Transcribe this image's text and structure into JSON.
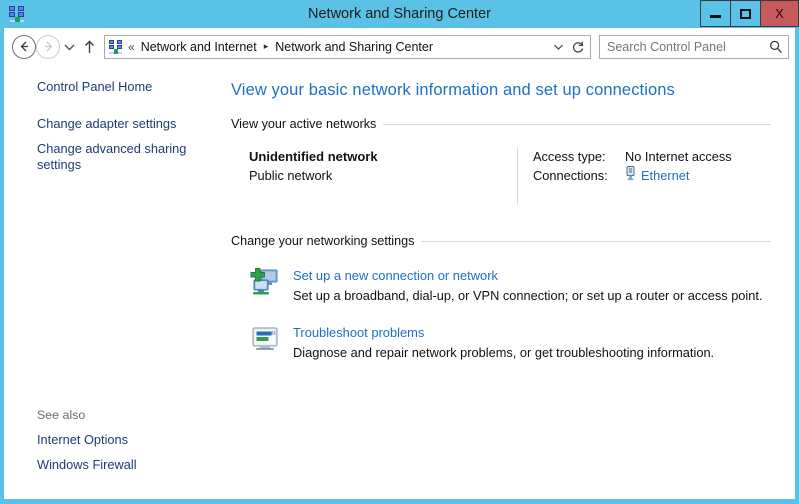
{
  "window": {
    "title": "Network and Sharing Center",
    "icon": "network-icon",
    "accent_color": "#5BC2E7",
    "close_color": "#C75B5B",
    "controls": {
      "minimize": "Minimize",
      "maximize": "Maximize",
      "close": "X"
    }
  },
  "navbar": {
    "back": "Back",
    "forward": "Forward",
    "recent_dropdown": "Recent locations",
    "up": "Up one level",
    "breadcrumb": {
      "prefix": "«",
      "items": [
        "Network and Internet",
        "Network and Sharing Center"
      ],
      "separator": "▸"
    },
    "address_dropdown": "Previous locations",
    "refresh": "Refresh",
    "search": {
      "placeholder": "Search Control Panel",
      "value": ""
    }
  },
  "sidebar": {
    "items": [
      {
        "label": "Control Panel Home"
      },
      {
        "label": "Change adapter settings"
      },
      {
        "label": "Change advanced sharing settings"
      }
    ],
    "see_also": {
      "label": "See also",
      "items": [
        {
          "label": "Internet Options"
        },
        {
          "label": "Windows Firewall"
        }
      ]
    }
  },
  "main": {
    "page_title": "View your basic network information and set up connections",
    "active_networks": {
      "heading": "View your active networks",
      "network": {
        "name": "Unidentified network",
        "type": "Public network",
        "access_type_label": "Access type:",
        "access_type_value": "No Internet access",
        "connections_label": "Connections:",
        "connection_name": "Ethernet",
        "connection_icon": "ethernet-icon"
      }
    },
    "networking_settings": {
      "heading": "Change your networking settings",
      "items": [
        {
          "icon": "new-connection-icon",
          "title": "Set up a new connection or network",
          "description": "Set up a broadband, dial-up, or VPN connection; or set up a router or access point."
        },
        {
          "icon": "troubleshoot-icon",
          "title": "Troubleshoot problems",
          "description": "Diagnose and repair network problems, or get troubleshooting information."
        }
      ]
    }
  }
}
